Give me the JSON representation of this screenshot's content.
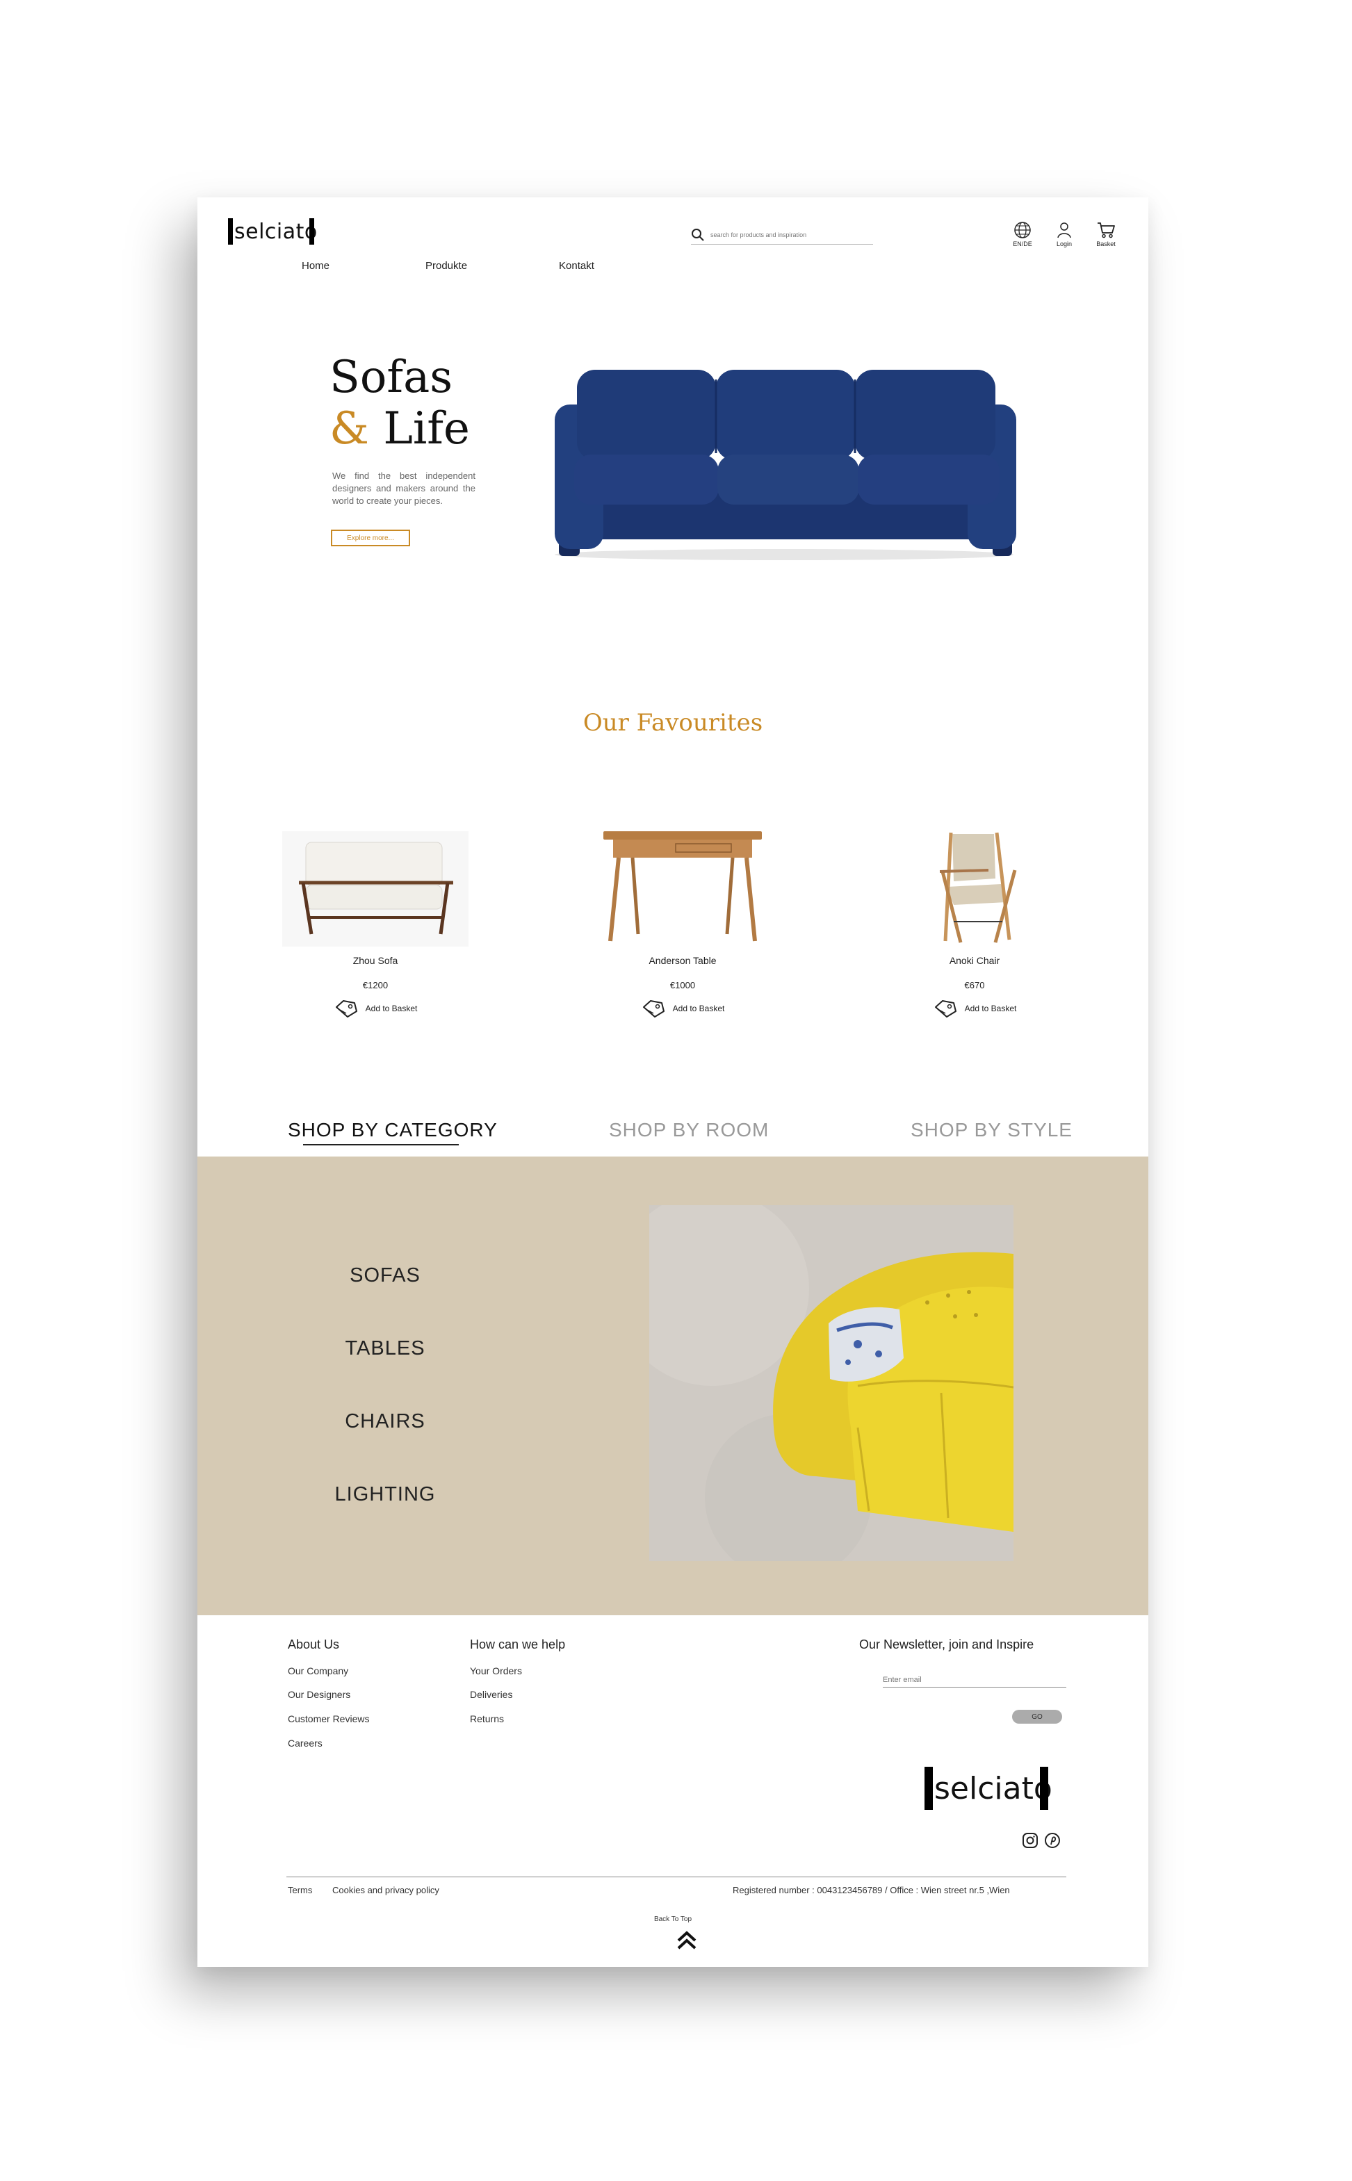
{
  "brand": {
    "logo_text": "selciato"
  },
  "header": {
    "search_placeholder": "search for products and inspiration",
    "tools": [
      {
        "icon": "globe-icon",
        "label": "EN/DE"
      },
      {
        "icon": "user-icon",
        "label": "Login"
      },
      {
        "icon": "cart-icon",
        "label": "Basket"
      }
    ],
    "nav": [
      "Home",
      "Produkte",
      "Kontakt"
    ]
  },
  "hero": {
    "title_line1": "Sofas",
    "title_amp": "&",
    "title_line2": " Life",
    "description": "We find the best independent designers and makers around the world to create your pieces.",
    "button": "Explore more..."
  },
  "favourites": {
    "title": "Our Favourites",
    "add_label": "Add to Basket",
    "products": [
      {
        "name": "Zhou Sofa",
        "price": "€1200"
      },
      {
        "name": "Anderson Table",
        "price": "€1000"
      },
      {
        "name": "Anoki Chair",
        "price": "€670"
      }
    ]
  },
  "shop": {
    "tabs": [
      "SHOP BY CATEGORY",
      "SHOP BY ROOM",
      "SHOP BY STYLE"
    ],
    "active_tab": 0,
    "categories": [
      "SOFAS",
      "TABLES",
      "CHAIRS",
      "LIGHTING"
    ]
  },
  "footer": {
    "col1_title": "About Us",
    "col1_links": [
      "Our Company",
      "Our Designers",
      "Customer Reviews",
      "Careers"
    ],
    "col2_title": "How can we help",
    "col2_links": [
      "Your Orders",
      "Deliveries",
      "Returns"
    ],
    "newsletter_title": "Our Newsletter, join and Inspire",
    "newsletter_placeholder": "Enter email",
    "go_label": "GO",
    "terms": "Terms",
    "cookies": "Cookies and privacy policy",
    "registered": "Registered number : 0043123456789 / Office : Wien street nr.5 ,Wien",
    "back_to_top": "Back To Top"
  },
  "colors": {
    "accent": "#c98a25",
    "panel": "#d6cab4",
    "sofa_blue": "#1f3a73",
    "yellow": "#e8cf2a"
  }
}
